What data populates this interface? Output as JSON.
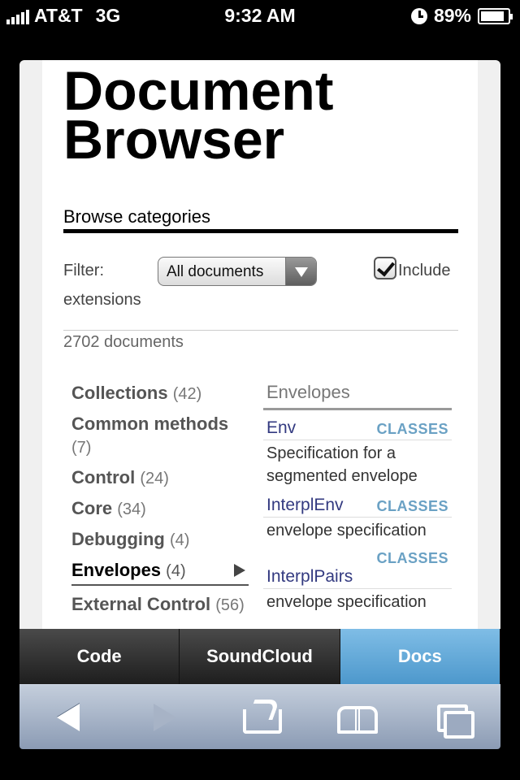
{
  "status_bar": {
    "carrier": "AT&T",
    "network": "3G",
    "time": "9:32 AM",
    "battery": "89%",
    "battery_level": 0.89
  },
  "page": {
    "title_line1": "Document",
    "title_line2": "Browser",
    "subtitle": "Browse categories",
    "filter_label": "Filter:",
    "filter_value": "All documents",
    "include_label": "Include",
    "extensions_label": "extensions",
    "include_checked": true,
    "doc_count": "2702 documents"
  },
  "categories": [
    {
      "name": "Collections",
      "count": "(42)"
    },
    {
      "name": "Common methods",
      "count": "(7)"
    },
    {
      "name": "Control",
      "count": "(24)"
    },
    {
      "name": "Core",
      "count": "(34)"
    },
    {
      "name": "Debugging",
      "count": "(4)"
    },
    {
      "name": "Envelopes",
      "count": "(4)",
      "active": true
    },
    {
      "name": "External Control",
      "count": "(56)"
    }
  ],
  "detail": {
    "heading": "Envelopes",
    "entries": [
      {
        "name": "Env",
        "tag": "CLASSES",
        "desc": "Specification for a segmented envelope"
      },
      {
        "name": "InterplEnv",
        "tag": "CLASSES",
        "desc": "envelope specification"
      },
      {
        "name": "InterplPairs",
        "tag": "CLASSES",
        "desc": "envelope specification"
      }
    ]
  },
  "tabs": [
    {
      "label": "Code",
      "active": false
    },
    {
      "label": "SoundCloud",
      "active": false
    },
    {
      "label": "Docs",
      "active": true
    }
  ],
  "toolbar": {
    "icons": [
      "back-icon",
      "forward-icon",
      "share-icon",
      "bookmarks-icon",
      "pages-icon"
    ]
  },
  "colors": {
    "active_tab": "#5fa6d6",
    "link": "#333a80",
    "tag": "#6aa1c4"
  }
}
